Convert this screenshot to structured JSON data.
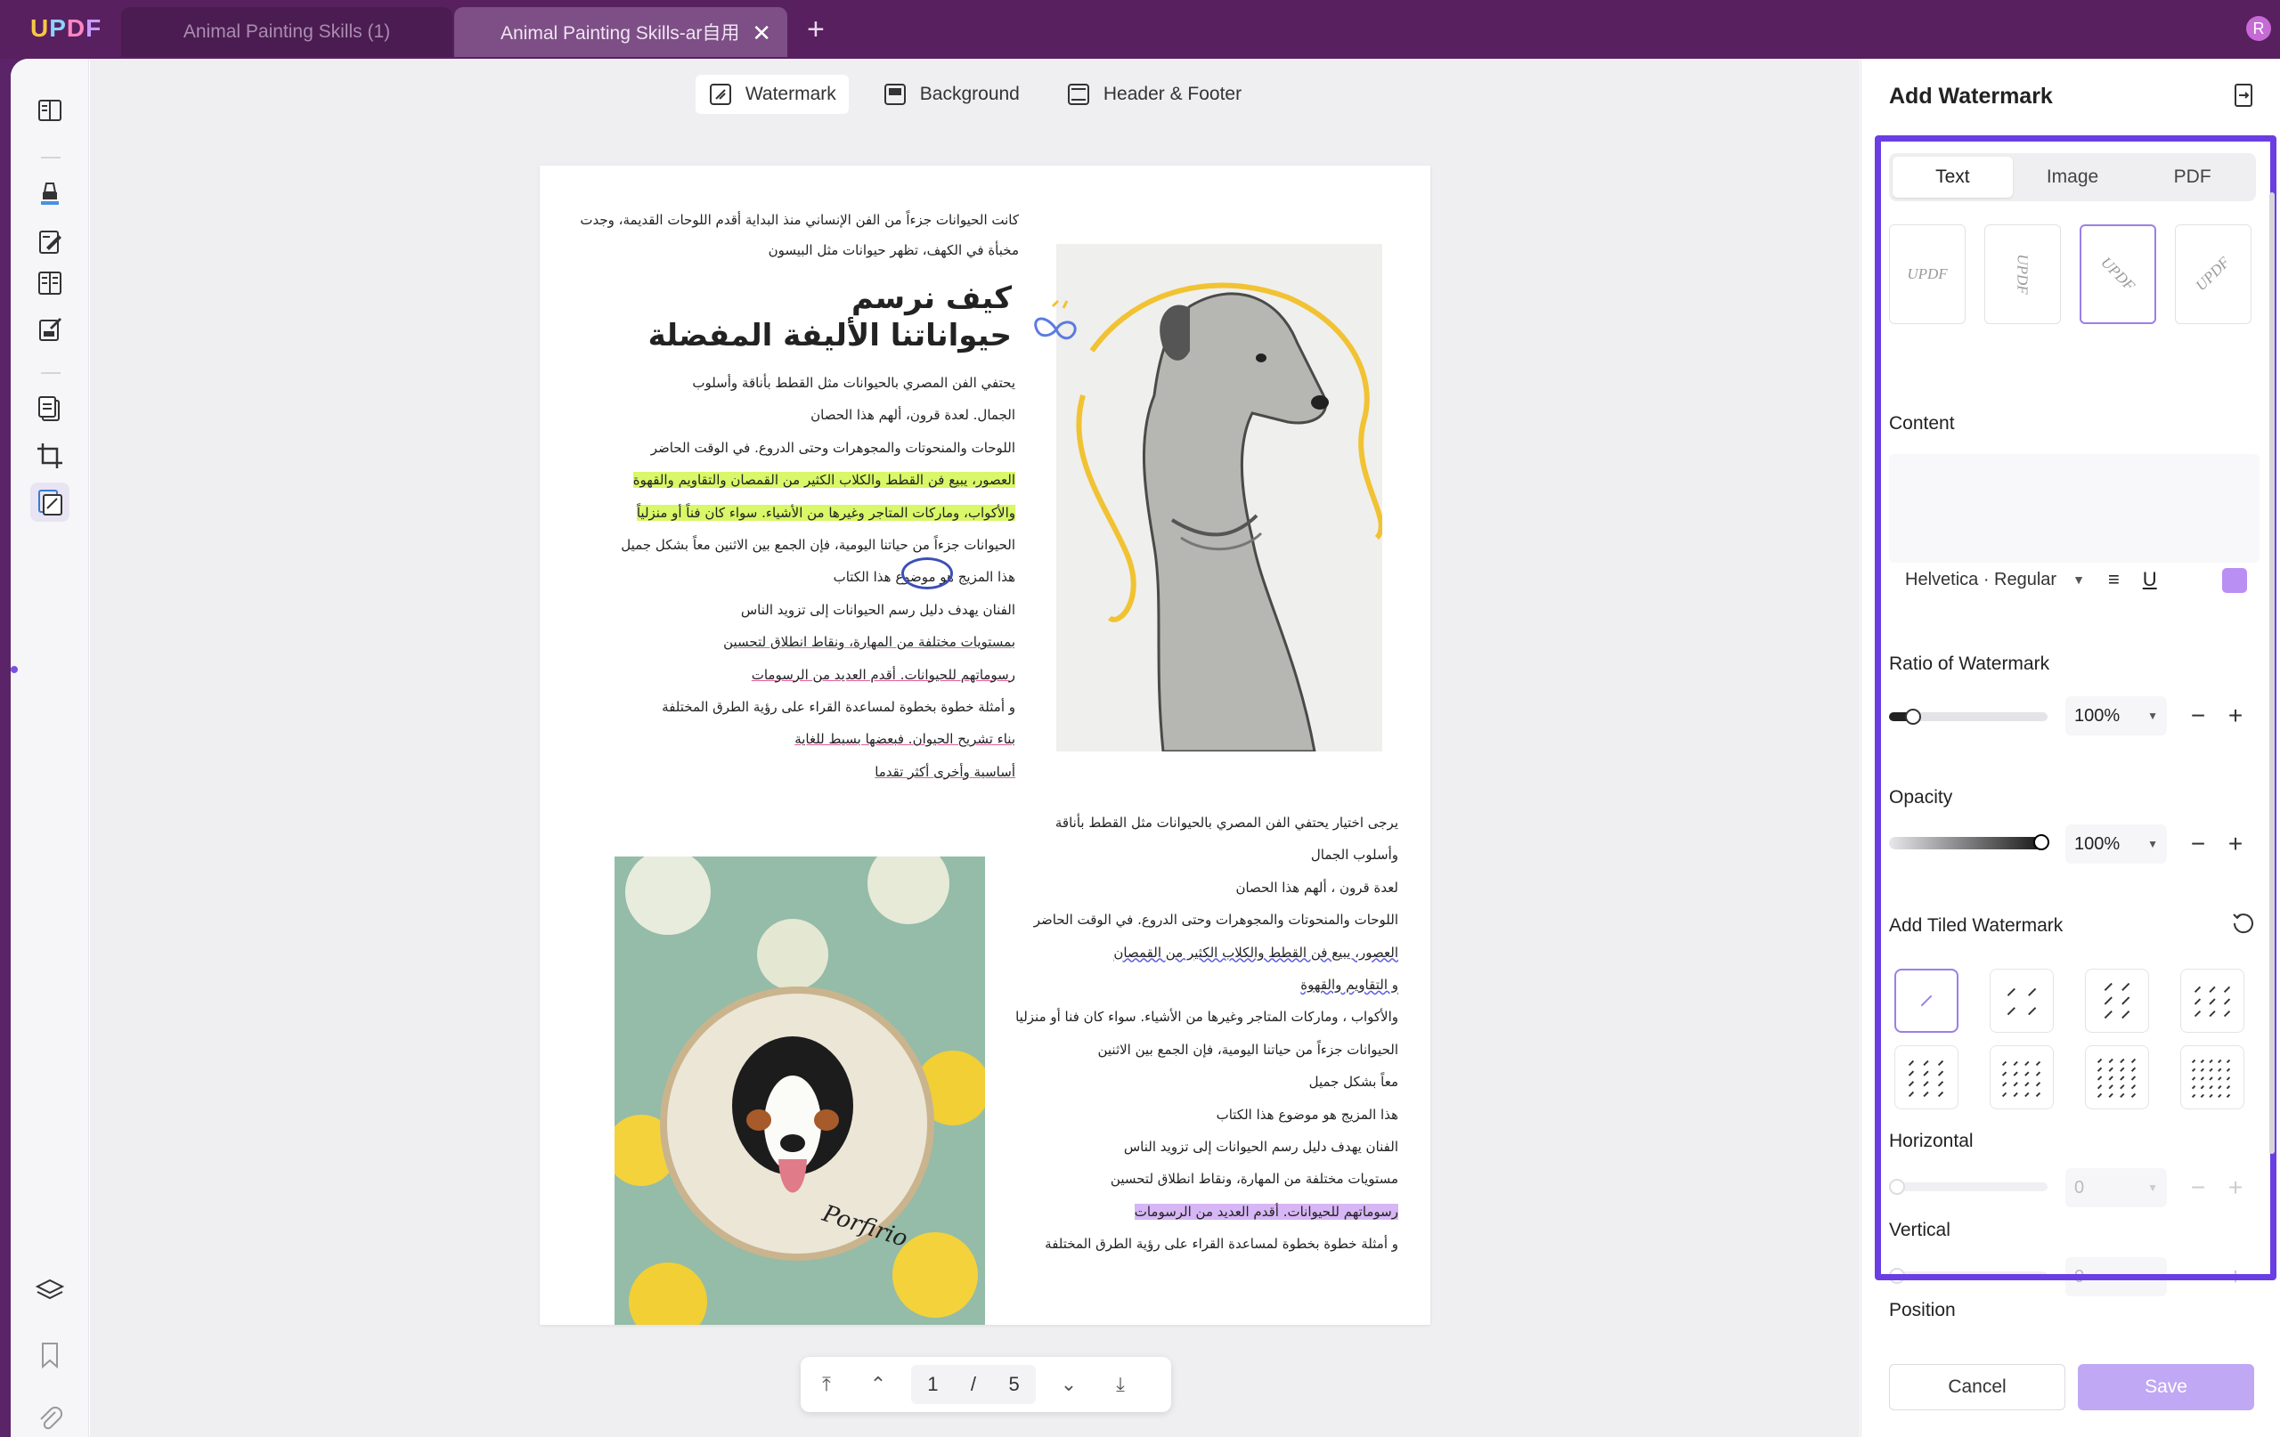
{
  "app": {
    "logo": [
      "U",
      "P",
      "D",
      "F"
    ]
  },
  "tabs": [
    {
      "label": "Animal Painting Skills (1)"
    },
    {
      "label": "Animal Painting Skills-ar自用"
    }
  ],
  "avatar_initial": "R",
  "edit_toolbar": {
    "watermark": "Watermark",
    "background": "Background",
    "header_footer": "Header & Footer"
  },
  "document": {
    "intro": [
      "كانت الحيوانات جزءاً من الفن الإنساني منذ البداية أقدم اللوحات القديمة، وجدت",
      "مخبأة في الكهف، تظهر حيوانات مثل البيسون"
    ],
    "heading": [
      "كيف نرسم",
      "حيواناتنا الأليفة المفضلة"
    ],
    "para1": [
      "يحتفي الفن المصري بالحيوانات مثل القطط بأناقة وأسلوب",
      "الجمال. لعدة قرون، ألهم هذا الحصان",
      "اللوحات والمنحوتات والمجوهرات وحتى الدروع. في الوقت الحاضر",
      "العصور، يبيع فن القطط والكلاب الكثير من القمصان والتقاويم والقهوة",
      "والأكواب، وماركات المتاجر وغيرها من الأشياء. سواء كان فناً أو منزلياً",
      "الحيوانات جزءاً من حياتنا اليومية، فإن الجمع بين الاثنين معاً بشكل جميل",
      "هذا المزيج هو موضوع هذا الكتاب",
      "الفنان يهدف دليل رسم الحيوانات إلى تزويد الناس",
      "بمستويات مختلفة من المهارة، ونقاط انطلاق لتحسين",
      "رسوماتهم للحيوانات. أقدم العديد من الرسومات",
      "و أمثلة خطوة بخطوة لمساعدة القراء على رؤية الطرق المختلفة",
      "بناء تشريح الحيوان. فبعضها بسيط للغاية",
      "أساسية وأخرى أكثر تقدما"
    ],
    "para2": [
      "يرجى اختيار يحتفي الفن المصري بالحيوانات مثل القطط بأناقة",
      "وأسلوب الجمال",
      "لعدة قرون ، ألهم هذا الحصان",
      "اللوحات والمنحوتات والمجوهرات وحتى الدروع. في الوقت الحاضر",
      "العصور، يبيع فن القطط والكلاب الكثير من القمصان",
      "و التقاويم والقهوة",
      "والأكواب ، وماركات المتاجر وغيرها من الأشياء. سواء كان فنا أو منزليا",
      "الحيوانات جزءاً من حياتنا اليومية، فإن الجمع بين الاثنين",
      "معاً بشكل جميل",
      "هذا المزيج هو موضوع هذا الكتاب",
      "الفنان يهدف دليل رسم الحيوانات إلى تزويد الناس",
      "مستويات مختلفة من المهارة، ونقاط انطلاق لتحسين",
      "رسوماتهم للحيوانات. أقدم العديد من الرسومات",
      "و أمثلة خطوة بخطوة لمساعدة القراء على رؤية الطرق المختلفة"
    ],
    "photo_caption": "Porfirio"
  },
  "pager": {
    "current": "1",
    "separator": "/",
    "total": "5"
  },
  "panel": {
    "title": "Add Watermark",
    "tabs": [
      "Text",
      "Image",
      "PDF"
    ],
    "preset_text": "UPDF",
    "content_label": "Content",
    "font": "Helvetica · Regular",
    "text_color": "#b98ff3",
    "ratio_label": "Ratio of Watermark",
    "ratio_value": "100%",
    "ratio_level": 0.15,
    "opacity_label": "Opacity",
    "opacity_value": "100%",
    "opacity_level": 1.0,
    "tiled_label": "Add Tiled Watermark",
    "horizontal_label": "Horizontal",
    "horizontal_value": "0",
    "vertical_label": "Vertical",
    "vertical_value": "0",
    "position_label": "Position",
    "cancel": "Cancel",
    "save": "Save"
  },
  "colors": {
    "accent": "#6a3ee2",
    "titlebar": "#58205f",
    "highlight_green": "#d9f768",
    "highlight_purple": "#d6b6f5"
  }
}
